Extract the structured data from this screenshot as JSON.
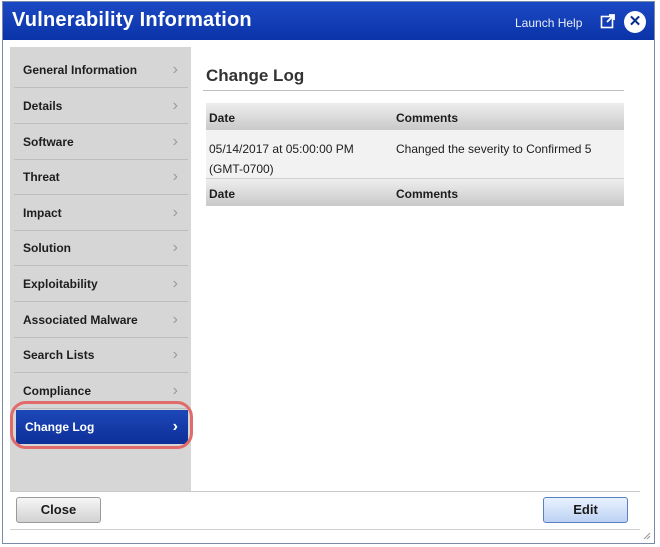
{
  "window": {
    "title": "Vulnerability Information",
    "launch_help": "Launch Help",
    "close_symbol": "✕"
  },
  "sidebar": {
    "items": [
      {
        "label": "General Information"
      },
      {
        "label": "Details"
      },
      {
        "label": "Software"
      },
      {
        "label": "Threat"
      },
      {
        "label": "Impact"
      },
      {
        "label": "Solution"
      },
      {
        "label": "Exploitability"
      },
      {
        "label": "Associated Malware"
      },
      {
        "label": "Search Lists"
      },
      {
        "label": "Compliance"
      },
      {
        "label": "Change Log",
        "selected": true
      }
    ],
    "chevron": "›"
  },
  "main": {
    "title": "Change Log",
    "table": {
      "headers": [
        "Date",
        "Comments"
      ],
      "rows": [
        {
          "date_line1": "05/14/2017 at 05:00:00 PM",
          "date_line2": "(GMT-0700)",
          "comment": "Changed the severity to Confirmed 5"
        }
      ],
      "footer_headers": [
        "Date",
        "Comments"
      ]
    }
  },
  "footer": {
    "close_label": "Close",
    "edit_label": "Edit"
  },
  "colors": {
    "titlebar": "#0b33a8",
    "selected_nav": "#1d47b8",
    "highlight_ring": "#e16a6a"
  },
  "icons": {
    "popout": "external-link-icon",
    "close": "close-icon",
    "chevron": "chevron-right-icon"
  }
}
